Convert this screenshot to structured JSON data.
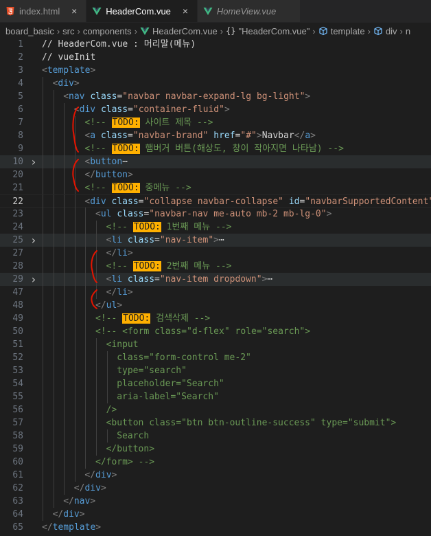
{
  "tabs": [
    {
      "label": "index.html",
      "icon": "html5-icon",
      "active": false,
      "italic": false,
      "close": "×"
    },
    {
      "label": "HeaderCom.vue",
      "icon": "vue-icon",
      "active": true,
      "italic": false,
      "close": "×"
    },
    {
      "label": "HomeView.vue",
      "icon": "vue-icon",
      "active": false,
      "italic": true,
      "close": ""
    }
  ],
  "breadcrumb": [
    {
      "label": "board_basic",
      "icon": ""
    },
    {
      "label": "src",
      "icon": ""
    },
    {
      "label": "components",
      "icon": ""
    },
    {
      "label": "HeaderCom.vue",
      "icon": "vue-icon"
    },
    {
      "label": "\"HeaderCom.vue\"",
      "icon": "braces-icon"
    },
    {
      "label": "template",
      "icon": "cube-icon"
    },
    {
      "label": "div",
      "icon": "cube-icon"
    },
    {
      "label": "n",
      "icon": ""
    }
  ],
  "colors": {
    "accent": "#007acc",
    "todo": "#ffb000",
    "comment": "#6a9955",
    "tag": "#569cd6",
    "attr": "#9cdcfe",
    "string": "#ce9178",
    "annotation": "#e51400"
  },
  "lines": [
    {
      "num": "1",
      "fold": "",
      "segs": [
        [
          "c",
          "// HeaderCom.vue : 머리말(메뉴)"
        ]
      ],
      "indent": 0,
      "text": true
    },
    {
      "num": "2",
      "fold": "",
      "segs": [
        [
          "t",
          "// vueInit"
        ]
      ],
      "indent": 0
    },
    {
      "num": "3",
      "fold": "",
      "segs": [
        [
          "g",
          "<"
        ],
        [
          "k",
          "template"
        ],
        [
          "g",
          ">"
        ]
      ],
      "indent": 0
    },
    {
      "num": "4",
      "fold": "",
      "segs": [
        [
          "g",
          "<"
        ],
        [
          "k",
          "div"
        ],
        [
          "g",
          ">"
        ]
      ],
      "indent": 1
    },
    {
      "num": "5",
      "fold": "",
      "segs": [
        [
          "g",
          "<"
        ],
        [
          "k",
          "nav"
        ],
        [
          "t",
          " "
        ],
        [
          "a",
          "class"
        ],
        [
          "t",
          "="
        ],
        [
          "s",
          "\"navbar navbar-expand-lg bg-light\""
        ],
        [
          "g",
          ">"
        ]
      ],
      "indent": 2
    },
    {
      "num": "6",
      "fold": "",
      "segs": [
        [
          "g",
          "<"
        ],
        [
          "k",
          "div"
        ],
        [
          "t",
          " "
        ],
        [
          "a",
          "class"
        ],
        [
          "t",
          "="
        ],
        [
          "s",
          "\"container-fluid\""
        ],
        [
          "g",
          ">"
        ]
      ],
      "indent": 3
    },
    {
      "num": "7",
      "fold": "",
      "segs": [
        [
          "c",
          "<!-- "
        ],
        [
          "todo",
          "TODO:"
        ],
        [
          "c",
          " 사이트 제목 -->"
        ]
      ],
      "indent": 4
    },
    {
      "num": "8",
      "fold": "",
      "segs": [
        [
          "g",
          "<"
        ],
        [
          "k",
          "a"
        ],
        [
          "t",
          " "
        ],
        [
          "a",
          "class"
        ],
        [
          "t",
          "="
        ],
        [
          "s",
          "\"navbar-brand\""
        ],
        [
          "t",
          " "
        ],
        [
          "a",
          "href"
        ],
        [
          "t",
          "="
        ],
        [
          "s",
          "\"#\""
        ],
        [
          "g",
          ">"
        ],
        [
          "t",
          "Navbar"
        ],
        [
          "g",
          "</"
        ],
        [
          "k",
          "a"
        ],
        [
          "g",
          ">"
        ]
      ],
      "indent": 4
    },
    {
      "num": "9",
      "fold": "",
      "segs": [
        [
          "c",
          "<!-- "
        ],
        [
          "todo",
          "TODO:"
        ],
        [
          "c",
          " 햄버거 버튼(해상도, 창이 작아지면 나타남) -->"
        ]
      ],
      "indent": 4
    },
    {
      "num": "10",
      "fold": ">",
      "segs": [
        [
          "g",
          "<"
        ],
        [
          "k",
          "button"
        ],
        [
          "e",
          "⋯"
        ]
      ],
      "indent": 4,
      "hl": true
    },
    {
      "num": "20",
      "fold": "",
      "segs": [
        [
          "g",
          "</"
        ],
        [
          "k",
          "button"
        ],
        [
          "g",
          ">"
        ]
      ],
      "indent": 4
    },
    {
      "num": "21",
      "fold": "",
      "segs": [
        [
          "c",
          "<!-- "
        ],
        [
          "todo",
          "TODO:"
        ],
        [
          "c",
          " 중메뉴 -->"
        ]
      ],
      "indent": 4
    },
    {
      "num": "22",
      "fold": "",
      "segs": [
        [
          "g",
          "<"
        ],
        [
          "k",
          "div"
        ],
        [
          "t",
          " "
        ],
        [
          "a",
          "class"
        ],
        [
          "t",
          "="
        ],
        [
          "s",
          "\"collapse navbar-collapse\""
        ],
        [
          "t",
          " "
        ],
        [
          "a",
          "id"
        ],
        [
          "t",
          "="
        ],
        [
          "s",
          "\"navbarSupportedContent\""
        ]
      ],
      "indent": 4,
      "cur": true
    },
    {
      "num": "23",
      "fold": "",
      "segs": [
        [
          "g",
          "<"
        ],
        [
          "k",
          "ul"
        ],
        [
          "t",
          " "
        ],
        [
          "a",
          "class"
        ],
        [
          "t",
          "="
        ],
        [
          "s",
          "\"navbar-nav me-auto mb-2 mb-lg-0\""
        ],
        [
          "g",
          ">"
        ]
      ],
      "indent": 5
    },
    {
      "num": "24",
      "fold": "",
      "segs": [
        [
          "c",
          "<!-- "
        ],
        [
          "todo",
          "TODO:"
        ],
        [
          "c",
          " 1번째 메뉴 -->"
        ]
      ],
      "indent": 6
    },
    {
      "num": "25",
      "fold": ">",
      "segs": [
        [
          "g",
          "<"
        ],
        [
          "k",
          "li"
        ],
        [
          "t",
          " "
        ],
        [
          "a",
          "class"
        ],
        [
          "t",
          "="
        ],
        [
          "s",
          "\"nav-item\""
        ],
        [
          "g",
          ">"
        ],
        [
          "e",
          "⋯"
        ]
      ],
      "indent": 6,
      "hl": true
    },
    {
      "num": "27",
      "fold": "",
      "segs": [
        [
          "g",
          "</"
        ],
        [
          "k",
          "li"
        ],
        [
          "g",
          ">"
        ]
      ],
      "indent": 6
    },
    {
      "num": "28",
      "fold": "",
      "segs": [
        [
          "c",
          "<!-- "
        ],
        [
          "todo",
          "TODO:"
        ],
        [
          "c",
          " 2번째 메뉴 -->"
        ]
      ],
      "indent": 6
    },
    {
      "num": "29",
      "fold": ">",
      "segs": [
        [
          "g",
          "<"
        ],
        [
          "k",
          "li"
        ],
        [
          "t",
          " "
        ],
        [
          "a",
          "class"
        ],
        [
          "t",
          "="
        ],
        [
          "s",
          "\"nav-item dropdown\""
        ],
        [
          "g",
          ">"
        ],
        [
          "e",
          "⋯"
        ]
      ],
      "indent": 6,
      "hl": true
    },
    {
      "num": "47",
      "fold": "",
      "segs": [
        [
          "g",
          "</"
        ],
        [
          "k",
          "li"
        ],
        [
          "g",
          ">"
        ]
      ],
      "indent": 6
    },
    {
      "num": "48",
      "fold": "",
      "segs": [
        [
          "g",
          "</"
        ],
        [
          "k",
          "ul"
        ],
        [
          "g",
          ">"
        ]
      ],
      "indent": 5
    },
    {
      "num": "49",
      "fold": "",
      "segs": [
        [
          "c",
          "<!-- "
        ],
        [
          "todo",
          "TODO:"
        ],
        [
          "c",
          " 검색삭제 -->"
        ]
      ],
      "indent": 5
    },
    {
      "num": "50",
      "fold": "",
      "segs": [
        [
          "c",
          "<!-- <form class=\"d-flex\" role=\"search\">"
        ]
      ],
      "indent": 5
    },
    {
      "num": "51",
      "fold": "",
      "segs": [
        [
          "c",
          "<input"
        ]
      ],
      "indent": 6
    },
    {
      "num": "52",
      "fold": "",
      "segs": [
        [
          "c",
          "class=\"form-control me-2\""
        ]
      ],
      "indent": 7
    },
    {
      "num": "53",
      "fold": "",
      "segs": [
        [
          "c",
          "type=\"search\""
        ]
      ],
      "indent": 7
    },
    {
      "num": "54",
      "fold": "",
      "segs": [
        [
          "c",
          "placeholder=\"Search\""
        ]
      ],
      "indent": 7
    },
    {
      "num": "55",
      "fold": "",
      "segs": [
        [
          "c",
          "aria-label=\"Search\""
        ]
      ],
      "indent": 7
    },
    {
      "num": "56",
      "fold": "",
      "segs": [
        [
          "c",
          "/>"
        ]
      ],
      "indent": 6
    },
    {
      "num": "57",
      "fold": "",
      "segs": [
        [
          "c",
          "<button class=\"btn btn-outline-success\" type=\"submit\">"
        ]
      ],
      "indent": 6
    },
    {
      "num": "58",
      "fold": "",
      "segs": [
        [
          "c",
          "Search"
        ]
      ],
      "indent": 7
    },
    {
      "num": "59",
      "fold": "",
      "segs": [
        [
          "c",
          "</button>"
        ]
      ],
      "indent": 6
    },
    {
      "num": "60",
      "fold": "",
      "segs": [
        [
          "c",
          "</form> -->"
        ]
      ],
      "indent": 5
    },
    {
      "num": "61",
      "fold": "",
      "segs": [
        [
          "g",
          "</"
        ],
        [
          "k",
          "div"
        ],
        [
          "g",
          ">"
        ]
      ],
      "indent": 4
    },
    {
      "num": "62",
      "fold": "",
      "segs": [
        [
          "g",
          "</"
        ],
        [
          "k",
          "div"
        ],
        [
          "g",
          ">"
        ]
      ],
      "indent": 3
    },
    {
      "num": "63",
      "fold": "",
      "segs": [
        [
          "g",
          "</"
        ],
        [
          "k",
          "nav"
        ],
        [
          "g",
          ">"
        ]
      ],
      "indent": 2
    },
    {
      "num": "64",
      "fold": "",
      "segs": [
        [
          "g",
          "</"
        ],
        [
          "k",
          "div"
        ],
        [
          "g",
          ">"
        ]
      ],
      "indent": 1
    },
    {
      "num": "65",
      "fold": "",
      "segs": [
        [
          "g",
          "</"
        ],
        [
          "k",
          "template"
        ],
        [
          "g",
          ">"
        ]
      ],
      "indent": 0
    }
  ]
}
